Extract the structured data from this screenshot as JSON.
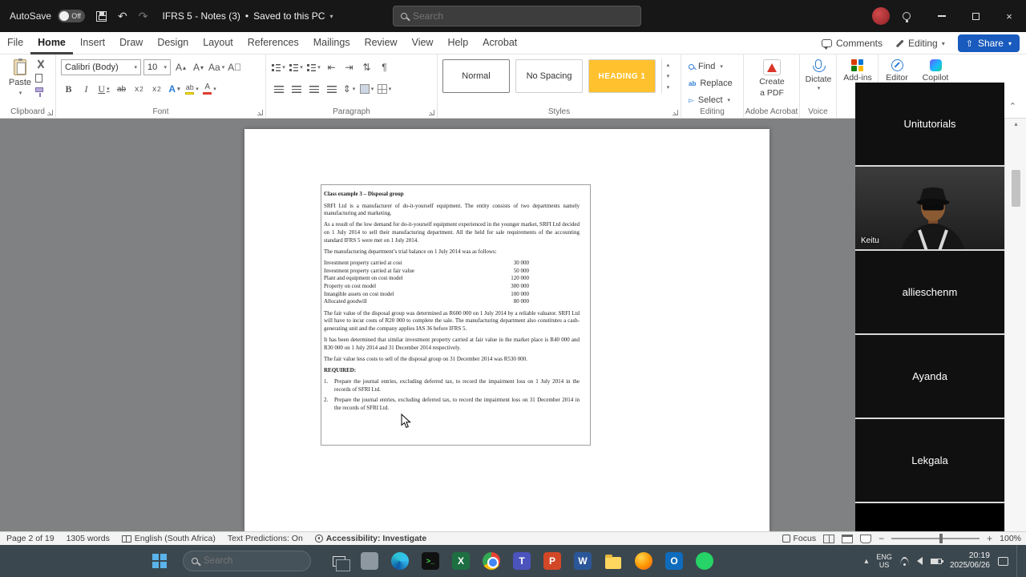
{
  "titlebar": {
    "autosave_label": "AutoSave",
    "autosave_state": "Off",
    "doc_title": "IFRS 5 - Notes (3)",
    "title_separator": "•",
    "save_status": "Saved to this PC",
    "search_placeholder": "Search"
  },
  "menubar": {
    "tabs": [
      {
        "label": "File"
      },
      {
        "label": "Home"
      },
      {
        "label": "Insert"
      },
      {
        "label": "Draw"
      },
      {
        "label": "Design"
      },
      {
        "label": "Layout"
      },
      {
        "label": "References"
      },
      {
        "label": "Mailings"
      },
      {
        "label": "Review"
      },
      {
        "label": "View"
      },
      {
        "label": "Help"
      },
      {
        "label": "Acrobat"
      }
    ],
    "comments_label": "Comments",
    "editing_label": "Editing",
    "share_label": "Share"
  },
  "ribbon": {
    "paste_label": "Paste",
    "font_name": "Calibri (Body)",
    "font_size": "10",
    "style_normal": "Normal",
    "style_no_spacing": "No Spacing",
    "style_heading1": "HEADING 1",
    "find_label": "Find",
    "replace_label": "Replace",
    "select_label": "Select",
    "create_pdf_line1": "Create",
    "create_pdf_line2": "a PDF",
    "dictate_label": "Dictate",
    "addins_label": "Add-ins",
    "editor_label": "Editor",
    "copilot_label": "Copilot",
    "group_clipboard": "Clipboard",
    "group_font": "Font",
    "group_paragraph": "Paragraph",
    "group_styles": "Styles",
    "group_editing": "Editing",
    "group_acrobat": "Adobe Acrobat",
    "group_voice": "Voice"
  },
  "document": {
    "heading": "Class example 3 – Disposal group",
    "para1": "SRFI Ltd is a manufacturer of do-it-yourself equipment. The entity consists of two departments namely manufacturing and marketing.",
    "para2": "As a result of the low demand for do-it-yourself equipment experienced in the younger market, SRFI Ltd decided on 1 July 2014 to sell their manufacturing department. All the held for sale requirements of the accounting standard IFRS 5 were met on 1 July 2014.",
    "para3": "The manufacturing department’s trial balance on 1 July 2014 was as follows:",
    "trial_balance": [
      {
        "item": "Investment property carried at cost",
        "amount": "30 000"
      },
      {
        "item": "Investment property carried at fair value",
        "amount": "50 000"
      },
      {
        "item": "Plant and equipment on cost model",
        "amount": "120 000"
      },
      {
        "item": "Property on cost model",
        "amount": "300 000"
      },
      {
        "item": "Intangible assets on cost model",
        "amount": "100 000"
      },
      {
        "item": "Allocated goodwill",
        "amount": "80 000"
      }
    ],
    "para4": "The fair value of the disposal group was determined as R600 000 on 1 July 2014 by a reliable valuator. SRFI Ltd will have to incur costs of R20 000 to complete the sale. The manufacturing department also constitutes a cash-generating unit and the company applies IAS 36 before IFRS 5.",
    "para5": "It has been determined that similar investment property carried at fair value in the market place is R40 000 and R30 000 on 1 July 2014 and 31 December 2014 respectively.",
    "para6": "The fair value less costs to sell of the disposal group on 31 December 2014 was R530 000.",
    "required_label": "REQUIRED:",
    "requirements": [
      {
        "num": "1.",
        "text": "Prepare the journal entries, excluding deferred tax, to record the impairment loss on 1 July 2014 in the records of SFRI Ltd."
      },
      {
        "num": "2.",
        "text": "Prepare the journal entries, excluding deferred tax, to record the impairment loss on 31 December 2014 in the records of SFRI Ltd."
      }
    ]
  },
  "participants": [
    {
      "name": "Unitutorials"
    },
    {
      "name": "Keitu"
    },
    {
      "name": "allieschenm"
    },
    {
      "name": "Ayanda"
    },
    {
      "name": "Lekgala"
    }
  ],
  "statusbar": {
    "page_info": "Page 2 of 19",
    "word_count": "1305 words",
    "language": "English (South Africa)",
    "predictions": "Text Predictions: On",
    "accessibility": "Accessibility: Investigate",
    "focus_label": "Focus",
    "zoom_level": "100%"
  },
  "taskbar": {
    "search_placeholder": "Search",
    "lang_line1": "ENG",
    "lang_line2": "US",
    "time": "20:19",
    "date": "2025/06/26"
  }
}
